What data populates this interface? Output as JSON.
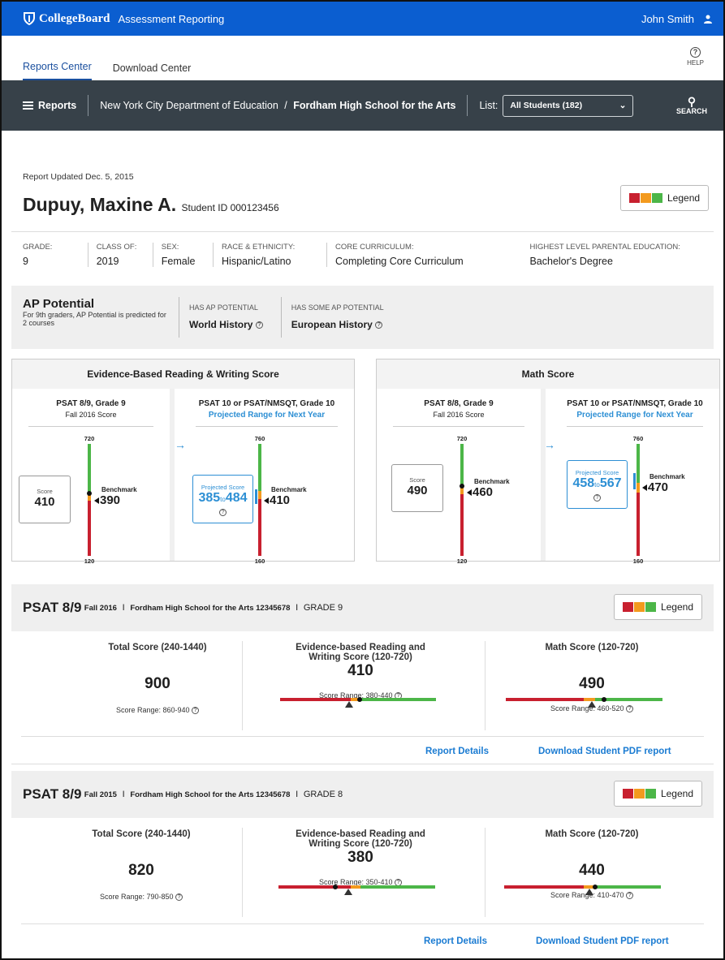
{
  "header": {
    "brand": "CollegeBoard",
    "app_title": "Assessment Reporting",
    "user_name": "John Smith"
  },
  "tabs": [
    {
      "label": "Reports Center",
      "active": true
    },
    {
      "label": "Download Center",
      "active": false
    }
  ],
  "help_label": "HELP",
  "navbar": {
    "reports_label": "Reports",
    "district": "New York City Department of Education",
    "separator": "/",
    "school": "Fordham High School for the Arts",
    "list_label": "List:",
    "list_value": "All Students (182)",
    "search_label": "SEARCH"
  },
  "student": {
    "updated": "Report Updated Dec. 5, 2015",
    "name": "Dupuy, Maxine A.",
    "id_text": "Student ID 000123456"
  },
  "legend_label": "Legend",
  "colors": {
    "red": "#c8202f",
    "orange": "#f39a1e",
    "green": "#4cb648",
    "blue": "#2d8fd4",
    "brand": "#0b5ed0"
  },
  "demographics": [
    {
      "label": "GRADE:",
      "value": "9"
    },
    {
      "label": "CLASS OF:",
      "value": "2019"
    },
    {
      "label": "SEX:",
      "value": "Female"
    },
    {
      "label": "RACE & ETHNICITY:",
      "value": "Hispanic/Latino"
    },
    {
      "label": "CORE CURRICULUM:",
      "value": "Completing Core Curriculum"
    },
    {
      "label": "HIGHEST LEVEL PARENTAL EDUCATION:",
      "value": "Bachelor's Degree"
    }
  ],
  "ap": {
    "title": "AP Potential",
    "subtitle": "For 9th graders, AP Potential is predicted for 2 courses",
    "has_label": "HAS AP POTENTIAL",
    "has_value": "World History",
    "some_label": "HAS SOME AP POTENTIAL",
    "some_value": "European History"
  },
  "panels": {
    "ebrw": {
      "title": "Evidence-Based Reading & Writing Score",
      "left": {
        "title": "PSAT 8/9, Grade 9",
        "sub": "Fall 2016 Score",
        "max": "720",
        "min": "120",
        "score_label": "Score",
        "score": "410",
        "bench_label": "Benchmark",
        "bench": "390"
      },
      "right": {
        "title": "PSAT 10 or PSAT/NMSQT, Grade 10",
        "sub": "Projected Range for Next Year",
        "max": "760",
        "min": "160",
        "proj_label": "Projected Score",
        "proj_low": "385",
        "proj_to": "to",
        "proj_high": "484",
        "bench_label": "Benchmark",
        "bench": "410"
      }
    },
    "math": {
      "title": "Math Score",
      "left": {
        "title": "PSAT 8/8, Grade 9",
        "sub": "Fall 2016 Score",
        "max": "720",
        "min": "120",
        "score_label": "Score",
        "score": "490",
        "bench_label": "Benchmark",
        "bench": "460"
      },
      "right": {
        "title": "PSAT 10 or PSAT/NMSQT, Grade 10",
        "sub": "Projected Range for Next Year",
        "max": "760",
        "min": "160",
        "proj_label": "Projected Score",
        "proj_low": "458",
        "proj_to": "to",
        "proj_high": "567",
        "bench_label": "Benchmark",
        "bench": "470"
      }
    }
  },
  "sections": [
    {
      "test": "PSAT 8/9",
      "term": "Fall 2016",
      "sep1": "I",
      "school": "Fordham High School for the Arts 12345678",
      "sep2": "I",
      "grade": "GRADE 9",
      "total_label": "Total Score (240-1440)",
      "total": "900",
      "total_range": "Score Range: 860-940",
      "ebrw_label": "Evidence-based Reading and Writing Score  (120-720)",
      "ebrw": "410",
      "ebrw_range": "Score Range: 380-440",
      "math_label": "Math Score (120-720)",
      "math": "490",
      "math_range": "Score Range: 460-520",
      "details": "Report Details",
      "download": "Download Student PDF report"
    },
    {
      "test": "PSAT 8/9",
      "term": "Fall 2015",
      "sep1": "I",
      "school": "Fordham High School for the Arts 12345678",
      "sep2": "I",
      "grade": "GRADE 8",
      "total_label": "Total Score (240-1440)",
      "total": "820",
      "total_range": "Score Range: 790-850",
      "ebrw_label": "Evidence-based Reading and Writing Score  (120-720)",
      "ebrw": "380",
      "ebrw_range": "Score Range: 350-410",
      "math_label": "Math Score (120-720)",
      "math": "440",
      "math_range": "Score Range: 410-470",
      "details": "Report Details",
      "download": "Download Student PDF report"
    }
  ]
}
